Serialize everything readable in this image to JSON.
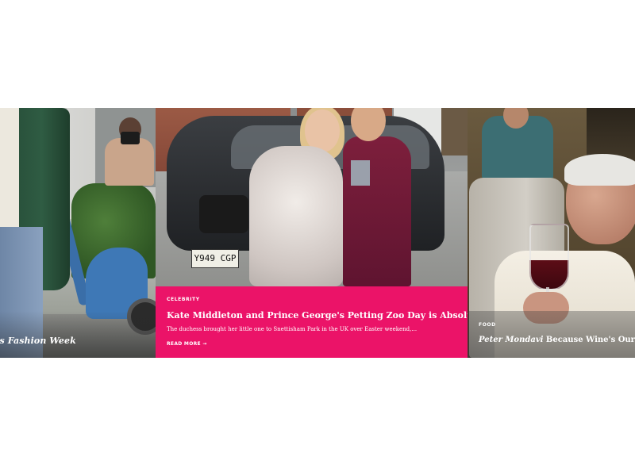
{
  "carousel": {
    "slides": [
      {
        "title": "'s Fashion Week"
      },
      {
        "category": "CELEBRITY",
        "title": "Kate Middleton and Prince George's Petting Zoo Day is Absolutely Adorable",
        "excerpt": "The duchess brought her little one to Snettisham Park in the UK over Easter weekend,...",
        "read_more": "READ MORE →",
        "plate": "Y949 CGP"
      },
      {
        "category": "FOOD",
        "title_name": "Peter Mondavi",
        "title_rest": " Because Wine's Our Middle Na"
      }
    ]
  },
  "colors": {
    "accent": "#eb1368",
    "text_on_image": "#ffffff"
  }
}
